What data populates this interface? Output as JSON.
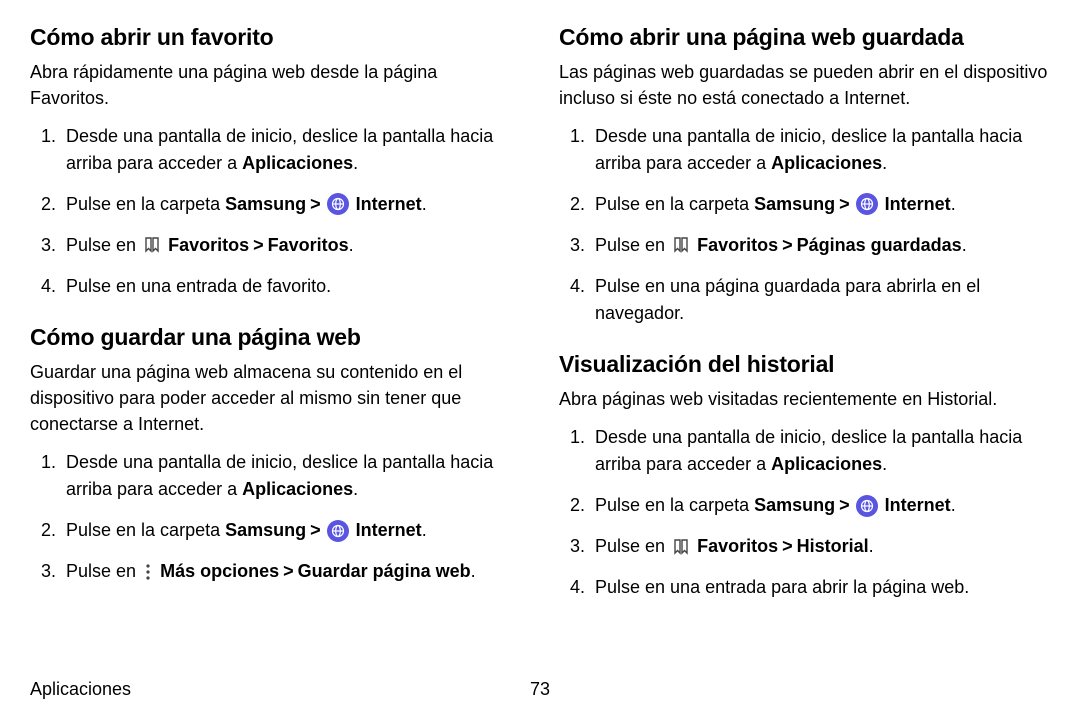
{
  "left": {
    "sec1": {
      "heading": "Cómo abrir un favorito",
      "intro": "Abra rápidamente una página web desde la página Favoritos.",
      "li1a": "Desde una pantalla de inicio, deslice la pantalla hacia arriba para acceder a ",
      "li1b": "Aplicaciones",
      "li1c": ".",
      "li2a": "Pulse en la carpeta ",
      "li2b": "Samsung",
      "li2c": "Internet",
      "li2d": ".",
      "li3a": "Pulse en ",
      "li3b": "Favoritos",
      "li3c": "Favoritos",
      "li3d": ".",
      "li4": "Pulse en una entrada de favorito."
    },
    "sec2": {
      "heading": "Cómo guardar una página web",
      "intro": "Guardar una página web almacena su contenido en el dispositivo para poder acceder al mismo sin tener que conectarse a Internet.",
      "li1a": "Desde una pantalla de inicio, deslice la pantalla hacia arriba para acceder a ",
      "li1b": "Aplicaciones",
      "li1c": ".",
      "li2a": "Pulse en la carpeta ",
      "li2b": "Samsung",
      "li2c": "Internet",
      "li2d": ".",
      "li3a": "Pulse en ",
      "li3b": "Más opciones",
      "li3c": "Guardar página web",
      "li3d": "."
    }
  },
  "right": {
    "sec1": {
      "heading": "Cómo abrir una página web guardada",
      "intro": "Las páginas web guardadas se pueden abrir en el dispositivo incluso si éste no está conectado a Internet.",
      "li1a": "Desde una pantalla de inicio, deslice la pantalla hacia arriba para acceder a ",
      "li1b": "Aplicaciones",
      "li1c": ".",
      "li2a": "Pulse en la carpeta ",
      "li2b": "Samsung",
      "li2c": "Internet",
      "li2d": ".",
      "li3a": "Pulse en ",
      "li3b": "Favoritos",
      "li3c": "Páginas guardadas",
      "li3d": ".",
      "li4": "Pulse en una página guardada para abrirla en el navegador."
    },
    "sec2": {
      "heading": "Visualización del historial",
      "intro": "Abra páginas web visitadas recientemente en Historial.",
      "li1a": "Desde una pantalla de inicio, deslice la pantalla hacia arriba para acceder a ",
      "li1b": "Aplicaciones",
      "li1c": ".",
      "li2a": "Pulse en la carpeta ",
      "li2b": "Samsung",
      "li2c": "Internet",
      "li2d": ".",
      "li3a": "Pulse en ",
      "li3b": "Favoritos",
      "li3c": "Historial",
      "li3d": ".",
      "li4": "Pulse en una entrada para abrir la página web."
    }
  },
  "footer": {
    "section": "Aplicaciones",
    "page": "73"
  },
  "glyphs": {
    "chevron": ">"
  }
}
